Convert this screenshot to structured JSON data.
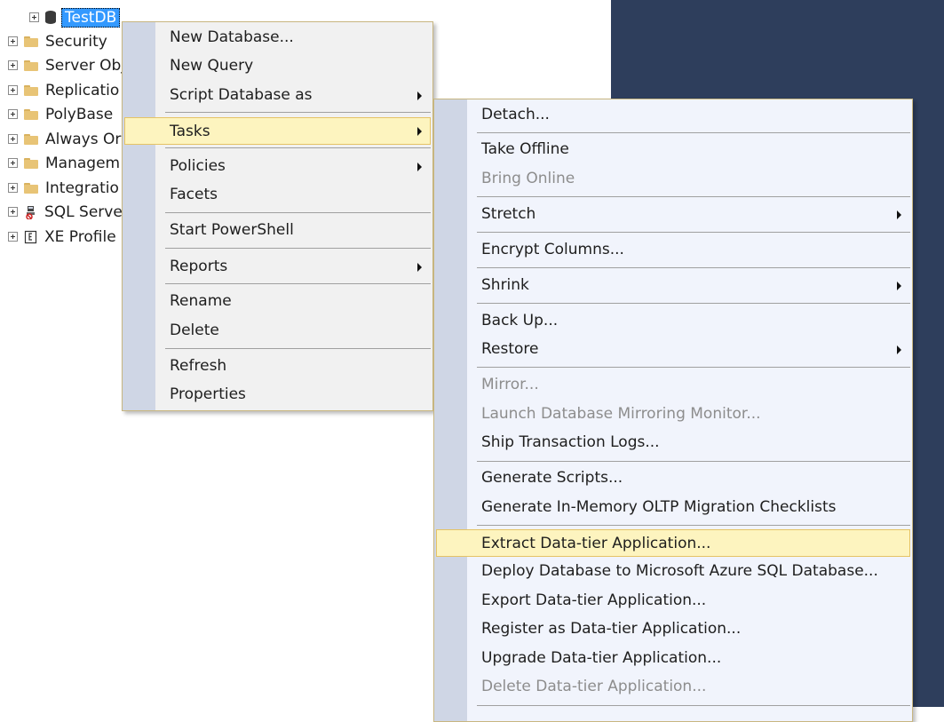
{
  "tree": {
    "items": [
      {
        "label": "TestDB",
        "icon": "database-icon",
        "selected": true
      },
      {
        "label": "Security",
        "icon": "folder-icon"
      },
      {
        "label": "Server Obj",
        "icon": "folder-icon"
      },
      {
        "label": "Replicatio",
        "icon": "folder-icon"
      },
      {
        "label": "PolyBase",
        "icon": "folder-icon"
      },
      {
        "label": "Always Or",
        "icon": "folder-icon"
      },
      {
        "label": "Managem",
        "icon": "folder-icon"
      },
      {
        "label": "Integratio",
        "icon": "folder-icon"
      },
      {
        "label": "SQL Serve",
        "icon": "sql-agent-icon"
      },
      {
        "label": "XE Profile",
        "icon": "xe-profiler-icon"
      }
    ]
  },
  "context_menu": {
    "items": {
      "new_database": "New Database...",
      "new_query": "New Query",
      "script_database_as": "Script Database as",
      "tasks": "Tasks",
      "policies": "Policies",
      "facets": "Facets",
      "start_powershell": "Start PowerShell",
      "reports": "Reports",
      "rename": "Rename",
      "delete": "Delete",
      "refresh": "Refresh",
      "properties": "Properties"
    }
  },
  "tasks_menu": {
    "items": {
      "detach": "Detach...",
      "take_offline": "Take Offline",
      "bring_online": "Bring Online",
      "stretch": "Stretch",
      "encrypt_columns": "Encrypt Columns...",
      "shrink": "Shrink",
      "back_up": "Back Up...",
      "restore": "Restore",
      "mirror": "Mirror...",
      "launch_mirroring_monitor": "Launch Database Mirroring Monitor...",
      "ship_transaction_logs": "Ship Transaction Logs...",
      "generate_scripts": "Generate Scripts...",
      "generate_oltp_checklists": "Generate In-Memory OLTP Migration Checklists",
      "extract_data_tier": "Extract Data-tier Application...",
      "deploy_to_azure": "Deploy Database to Microsoft Azure SQL Database...",
      "export_data_tier": "Export Data-tier Application...",
      "register_data_tier": "Register as Data-tier Application...",
      "upgrade_data_tier": "Upgrade Data-tier Application...",
      "delete_data_tier": "Delete Data-tier Application..."
    },
    "disabled": [
      "Bring Online",
      "Mirror...",
      "Launch Database Mirroring Monitor...",
      "Delete Data-tier Application..."
    ],
    "highlighted": "Extract Data-tier Application..."
  },
  "colors": {
    "highlight_bg": "#fdf4bf",
    "highlight_border": "#e5c365",
    "gutter": "#cfd6e5",
    "selection": "#3399ff",
    "background_pane": "#2e3e5c"
  }
}
